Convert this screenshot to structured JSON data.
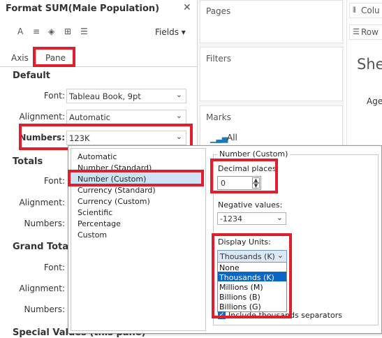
{
  "format_pane": {
    "title": "Format SUM(Male Population)",
    "fields_label": "Fields ▾",
    "tabs": {
      "axis": "Axis",
      "pane": "Pane"
    },
    "default_section": {
      "title": "Default",
      "font_label": "Font:",
      "font_value": "Tableau Book, 9pt",
      "alignment_label": "Alignment:",
      "alignment_value": "Automatic",
      "numbers_label": "Numbers:",
      "numbers_value": "123K"
    },
    "totals_section": {
      "title": "Totals",
      "font_label": "Font:",
      "alignment_label": "Alignment:",
      "numbers_label": "Numbers:"
    },
    "grand_totals_section": {
      "title": "Grand Totals",
      "font_label": "Font:",
      "alignment_label": "Alignment:",
      "numbers_label": "Numbers:"
    },
    "special_values_title": "Special Values (this pane)"
  },
  "shelves": {
    "pages": "Pages",
    "filters": "Filters",
    "marks": "Marks",
    "marks_type": "All",
    "columns": "Colu",
    "rows": "Row",
    "sheet_title": "She",
    "age_header": "Age"
  },
  "numbers_popup": {
    "formats": [
      "Automatic",
      "Number (Standard)",
      "Number (Custom)",
      "Currency (Standard)",
      "Currency (Custom)",
      "Scientific",
      "Percentage",
      "Custom"
    ],
    "selected_format": "Number (Custom)",
    "group_title": "Number (Custom)",
    "decimal_label": "Decimal places:",
    "decimal_value": "0",
    "negative_label": "Negative values:",
    "negative_value": "-1234",
    "display_units_label": "Display Units:",
    "display_units_value": "Thousands (K)",
    "display_unit_options": [
      "None",
      "Thousands (K)",
      "Millions (M)",
      "Billions (B)",
      "Billions (G)"
    ],
    "thousands_separator_label": "Include thousands separators",
    "thousands_separator_checked": true
  },
  "colors": {
    "highlight": "#e01e2c",
    "selection": "#0a67c7",
    "list_selection": "#cde4f7"
  }
}
